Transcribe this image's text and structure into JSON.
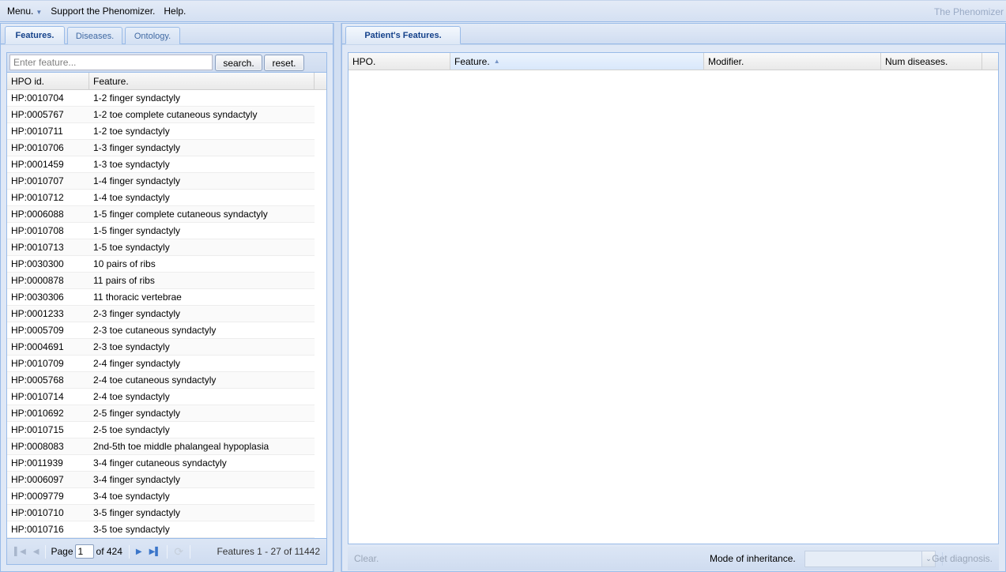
{
  "menubar": {
    "items": [
      {
        "label": "Menu.",
        "has_dropdown": true
      },
      {
        "label": "Support the Phenomizer."
      },
      {
        "label": "Help."
      }
    ],
    "app_title": "The Phenomizer"
  },
  "left_panel": {
    "tabs": [
      {
        "label": "Features.",
        "active": true
      },
      {
        "label": "Diseases.",
        "active": false
      },
      {
        "label": "Ontology.",
        "active": false
      }
    ],
    "search": {
      "placeholder": "Enter feature...",
      "value": "",
      "search_label": "search.",
      "reset_label": "reset."
    },
    "columns": [
      "HPO id.",
      "Feature."
    ],
    "rows": [
      {
        "id": "HP:0010704",
        "feature": "1-2 finger syndactyly"
      },
      {
        "id": "HP:0005767",
        "feature": "1-2 toe complete cutaneous syndactyly"
      },
      {
        "id": "HP:0010711",
        "feature": "1-2 toe syndactyly"
      },
      {
        "id": "HP:0010706",
        "feature": "1-3 finger syndactyly"
      },
      {
        "id": "HP:0001459",
        "feature": "1-3 toe syndactyly"
      },
      {
        "id": "HP:0010707",
        "feature": "1-4 finger syndactyly"
      },
      {
        "id": "HP:0010712",
        "feature": "1-4 toe syndactyly"
      },
      {
        "id": "HP:0006088",
        "feature": "1-5 finger complete cutaneous syndactyly"
      },
      {
        "id": "HP:0010708",
        "feature": "1-5 finger syndactyly"
      },
      {
        "id": "HP:0010713",
        "feature": "1-5 toe syndactyly"
      },
      {
        "id": "HP:0030300",
        "feature": "10 pairs of ribs"
      },
      {
        "id": "HP:0000878",
        "feature": "11 pairs of ribs"
      },
      {
        "id": "HP:0030306",
        "feature": "11 thoracic vertebrae"
      },
      {
        "id": "HP:0001233",
        "feature": "2-3 finger syndactyly"
      },
      {
        "id": "HP:0005709",
        "feature": "2-3 toe cutaneous syndactyly"
      },
      {
        "id": "HP:0004691",
        "feature": "2-3 toe syndactyly"
      },
      {
        "id": "HP:0010709",
        "feature": "2-4 finger syndactyly"
      },
      {
        "id": "HP:0005768",
        "feature": "2-4 toe cutaneous syndactyly"
      },
      {
        "id": "HP:0010714",
        "feature": "2-4 toe syndactyly"
      },
      {
        "id": "HP:0010692",
        "feature": "2-5 finger syndactyly"
      },
      {
        "id": "HP:0010715",
        "feature": "2-5 toe syndactyly"
      },
      {
        "id": "HP:0008083",
        "feature": "2nd-5th toe middle phalangeal hypoplasia"
      },
      {
        "id": "HP:0011939",
        "feature": "3-4 finger cutaneous syndactyly"
      },
      {
        "id": "HP:0006097",
        "feature": "3-4 finger syndactyly"
      },
      {
        "id": "HP:0009779",
        "feature": "3-4 toe syndactyly"
      },
      {
        "id": "HP:0010710",
        "feature": "3-5 finger syndactyly"
      },
      {
        "id": "HP:0010716",
        "feature": "3-5 toe syndactyly"
      }
    ],
    "paging": {
      "page_label": "Page",
      "page_value": "1",
      "of_label": "of 424",
      "status": "Features 1 - 27 of 11442"
    }
  },
  "right_panel": {
    "tabs": [
      {
        "label": "Patient's Features.",
        "active": true
      }
    ],
    "columns": [
      "HPO.",
      "Feature.",
      "Modifier.",
      "Num diseases."
    ],
    "sorted_column": "Feature.",
    "sort_direction": "ascending",
    "rows": [],
    "toolbar": {
      "clear_label": "Clear.",
      "moi_label": "Mode of inheritance.",
      "moi_value": "",
      "diagnosis_label": "Get diagnosis."
    }
  }
}
